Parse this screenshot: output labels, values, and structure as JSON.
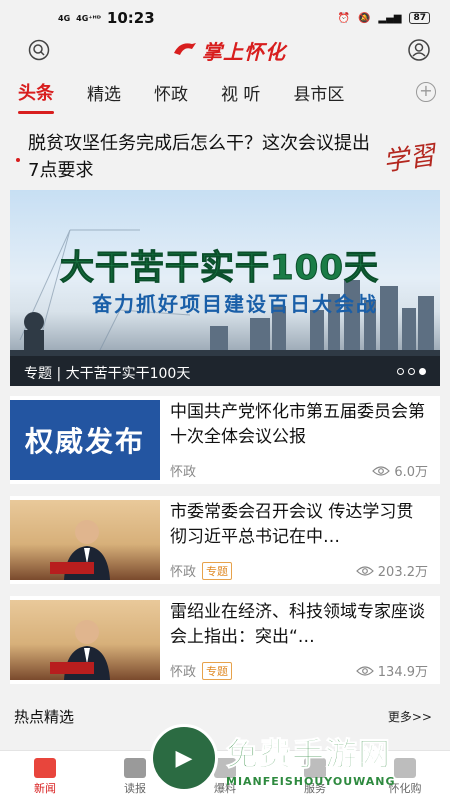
{
  "status_bar": {
    "signal1": "4G",
    "signal2": "4G⁺ᴴᴰ",
    "time": "10:23",
    "battery": "87"
  },
  "app": {
    "logo_text": "掌上怀化",
    "brand_color": "#d81e1e"
  },
  "tabs": [
    {
      "label": "头条",
      "active": true
    },
    {
      "label": "精选"
    },
    {
      "label": "怀政"
    },
    {
      "label": "视 听"
    },
    {
      "label": "县市区"
    }
  ],
  "headline": {
    "text": "脱贫攻坚任务完成后怎么干？这次会议提出7点要求",
    "badge": "学習"
  },
  "banner": {
    "title1": "大干苦干实干100天",
    "title2": "奋力抓好项目建设百日大会战",
    "caption": "专题 | 大干苦干实干100天"
  },
  "news": [
    {
      "thumb_text": "权威发布",
      "title": "中国共产党怀化市第五届委员会第十次全体会议公报",
      "source": "怀政",
      "tag": "",
      "views": "6.0万"
    },
    {
      "thumb_text": "",
      "title": "市委常委会召开会议  传达学习贯彻习近平总书记在中…",
      "source": "怀政",
      "tag": "专题",
      "views": "203.2万"
    },
    {
      "thumb_text": "",
      "title": "雷绍业在经济、科技领域专家座谈会上指出：突出“…",
      "source": "怀政",
      "tag": "专题",
      "views": "134.9万"
    }
  ],
  "hot": {
    "heading": "热点精选",
    "more": "更多>>"
  },
  "bottom_nav": [
    {
      "label": "新闻",
      "active": true
    },
    {
      "label": "读报"
    },
    {
      "label": "爆料"
    },
    {
      "label": "服务"
    },
    {
      "label": "怀化购"
    }
  ],
  "watermark": {
    "cn": "免费手游网",
    "en": "MIANFEISHOUYOUWANG"
  }
}
